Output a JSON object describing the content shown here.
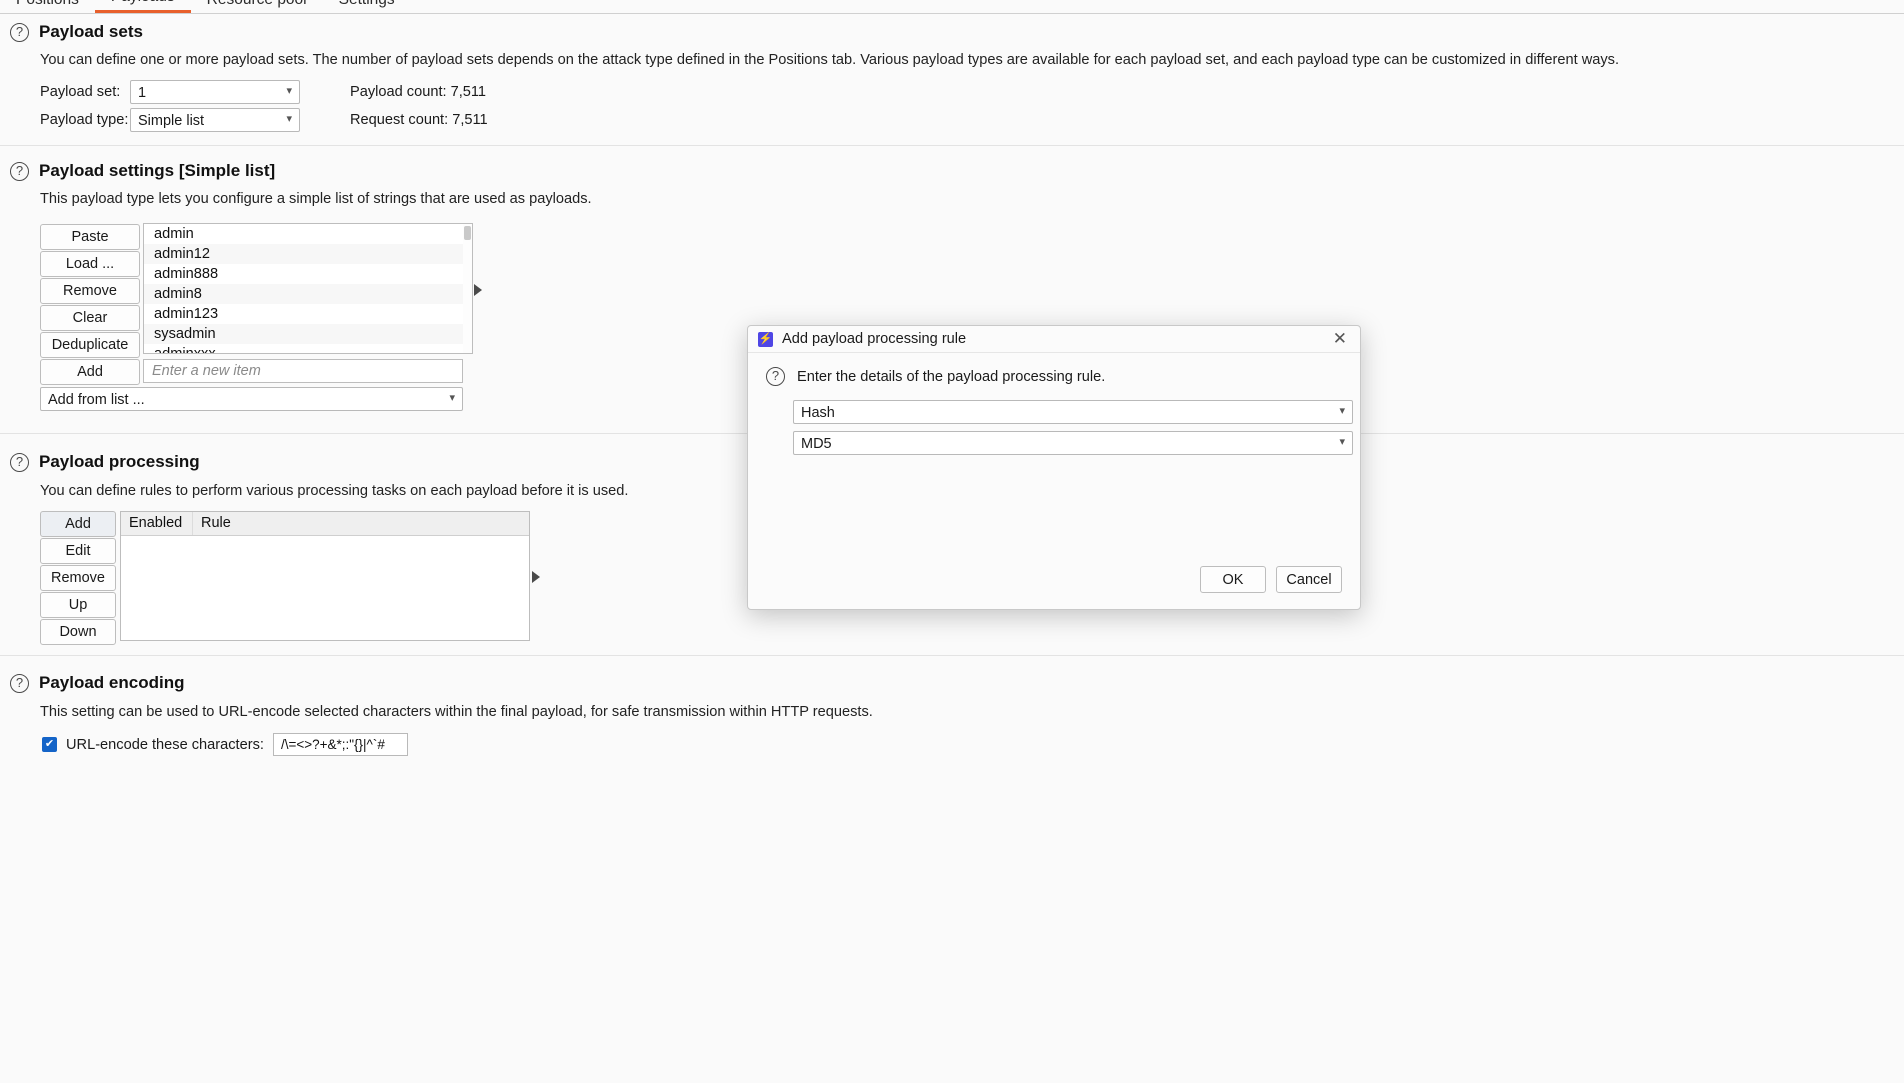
{
  "tabs": [
    {
      "label": "Positions",
      "active": false
    },
    {
      "label": "Payloads",
      "active": true
    },
    {
      "label": "Resource pool",
      "active": false
    },
    {
      "label": "Settings",
      "active": false
    }
  ],
  "payload_sets": {
    "title": "Payload sets",
    "description": "You can define one or more payload sets. The number of payload sets depends on the attack type defined in the Positions tab. Various payload types are available for each payload set, and each payload type can be customized in different ways.",
    "payload_set_label": "Payload set:",
    "payload_set_value": "1",
    "payload_type_label": "Payload type:",
    "payload_type_value": "Simple list",
    "payload_count_label": "Payload count: 7,511",
    "request_count_label": "Request count: 7,511",
    "help_icon": "question-icon"
  },
  "payload_settings": {
    "title": "Payload settings [Simple list]",
    "description": "This payload type lets you configure a simple list of strings that are used as payloads.",
    "buttons": [
      "Paste",
      "Load ...",
      "Remove",
      "Clear",
      "Deduplicate",
      "Add"
    ],
    "items": [
      "admin",
      "admin12",
      "admin888",
      "admin8",
      "admin123",
      "sysadmin",
      "adminxxx"
    ],
    "new_item_placeholder": "Enter a new item",
    "add_from_list_label": "Add from list ...",
    "expand_icon": "triangle-right-icon"
  },
  "payload_processing": {
    "title": "Payload processing",
    "description": "You can define rules to perform various processing tasks on each payload before it is used.",
    "buttons": [
      "Add",
      "Edit",
      "Remove",
      "Up",
      "Down"
    ],
    "columns": [
      "Enabled",
      "Rule"
    ],
    "rows": [],
    "expand_icon": "triangle-right-icon"
  },
  "payload_encoding": {
    "title": "Payload encoding",
    "description": "This setting can be used to URL-encode selected characters within the final payload, for safe transmission within HTTP requests.",
    "checkbox_checked": true,
    "checkbox_label": "URL-encode these characters:",
    "characters_value": "/\\=<>?+&*;:\"{}|^`#"
  },
  "modal": {
    "title": "Add payload processing rule",
    "icon": "burp-lightning-icon",
    "close_icon": "close-icon",
    "help_icon": "question-icon",
    "prompt": "Enter the details of the payload processing rule.",
    "rule_type_value": "Hash",
    "hash_algo_value": "MD5",
    "ok_label": "OK",
    "cancel_label": "Cancel"
  },
  "colors": {
    "accent": "#e8602c",
    "checkbox": "#1464c8",
    "modal_icon": "#4f46e5"
  }
}
